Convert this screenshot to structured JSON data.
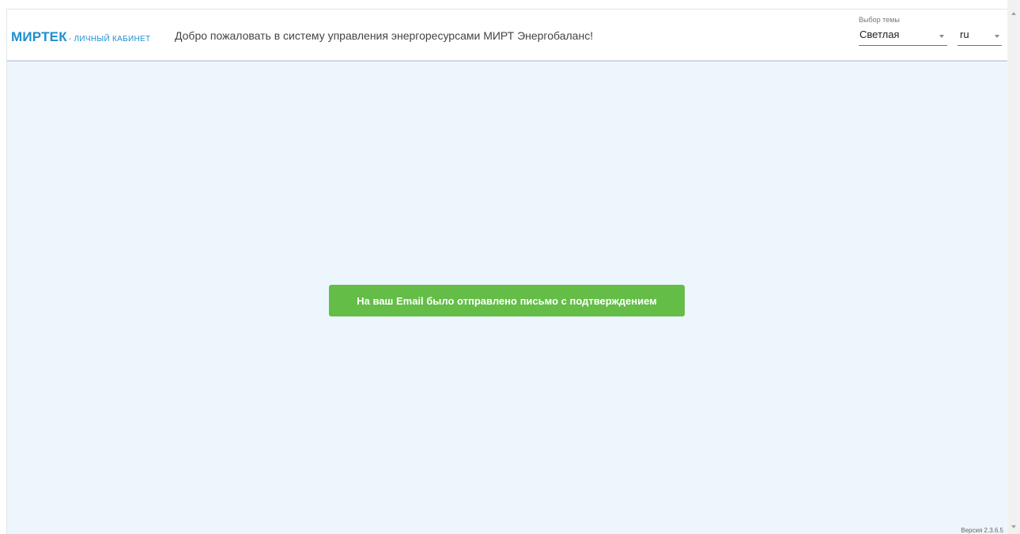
{
  "header": {
    "logo_mark": "МИРТЕК",
    "logo_sub": "- ЛИЧНЫЙ КАБИНЕТ",
    "welcome": "Добро пожаловать в систему управления энергоресурсами МИРТ Энергобаланс!",
    "theme_select": {
      "caption": "Выбор темы",
      "value": "Светлая"
    },
    "language_select": {
      "value": "ru"
    }
  },
  "notification": {
    "message": "На ваш Email было отправлено письмо с подтверждением"
  },
  "footer": {
    "version": "Версия 2.3.6.5"
  },
  "icons": {
    "theme_dropdown": "chevron-down-icon",
    "language_dropdown": "chevron-down-icon",
    "scroll_up": "scroll-up-arrow-icon",
    "scroll_down": "scroll-down-arrow-icon"
  },
  "colors": {
    "brand": "#1e8fd0",
    "content_background": "#eef6fd",
    "notification_background": "#63bd46",
    "notification_text": "#ffffff",
    "input_underline": "#1e88d4"
  }
}
